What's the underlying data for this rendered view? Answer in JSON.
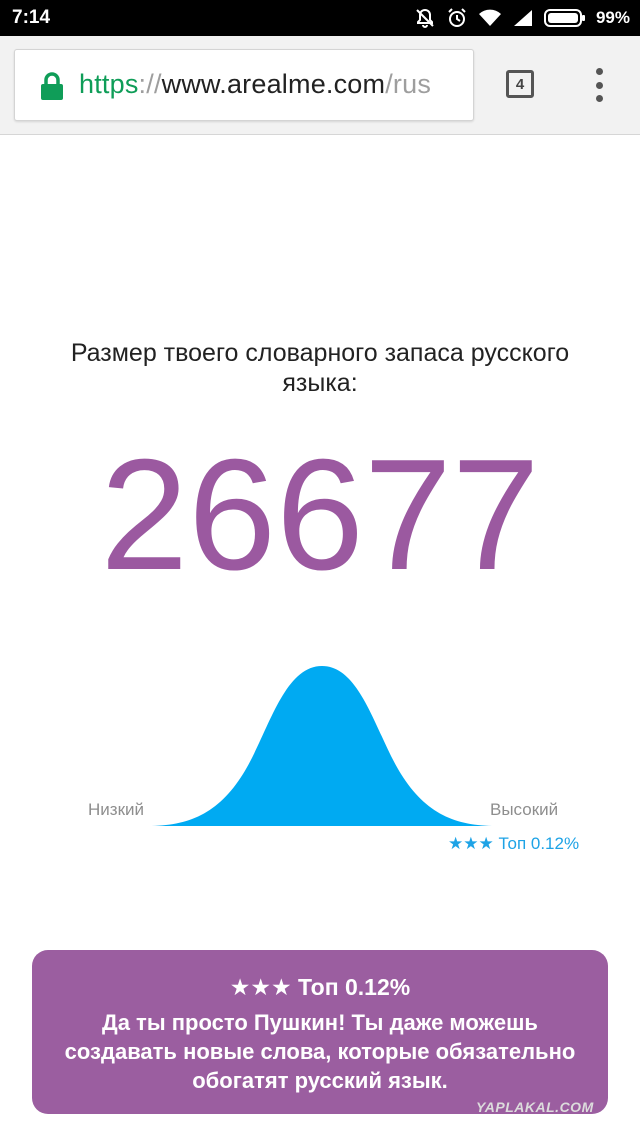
{
  "status_bar": {
    "time": "7:14",
    "battery_percent": "99%",
    "icons": [
      "mute-icon",
      "alarm-icon",
      "wifi-icon",
      "signal-icon",
      "battery-icon"
    ]
  },
  "browser": {
    "url_scheme": "https",
    "url_separator": "://",
    "url_host": "www.arealme.com",
    "url_path": "/rus",
    "tab_count": "4",
    "colors": {
      "secure": "#0f9d58"
    }
  },
  "result": {
    "heading": "Размер твоего словарного запаса русского языка:",
    "score": "26677",
    "score_color": "#9b59a0"
  },
  "distribution": {
    "label_low": "Низкий",
    "label_high": "Высокий",
    "rank_label": "★★★ Топ 0.12%",
    "color": "#00aaf2"
  },
  "card": {
    "rank": "★★★ Топ 0.12%",
    "message": "Да ты просто Пушкин! Ты даже можешь создавать новые слова, которые обязательно обогатят русский язык.",
    "color": "#9b5ea0"
  },
  "watermark": "YAPLAKAL.COM"
}
